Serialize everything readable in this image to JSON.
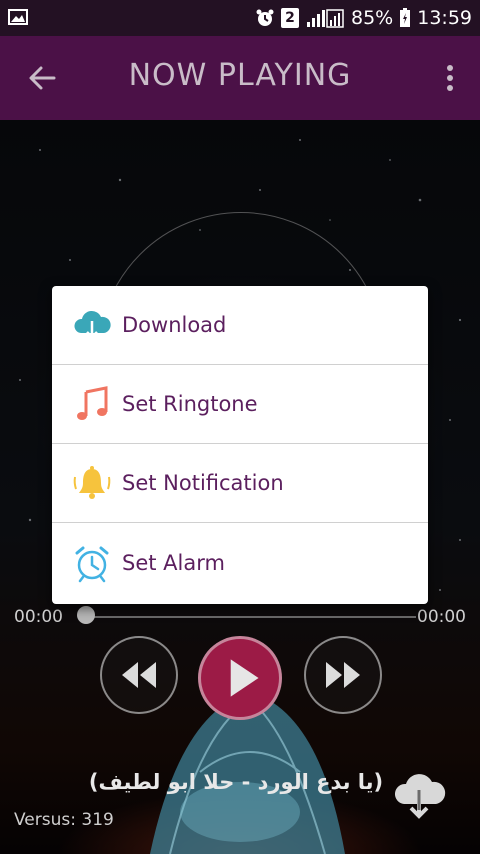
{
  "status_bar": {
    "sim_badge": "2",
    "battery": "85%",
    "time": "13:59"
  },
  "app_bar": {
    "title": "NOW PLAYING"
  },
  "player": {
    "elapsed": "00:00",
    "duration": "00:00",
    "progress": 0,
    "track_title": "(يا بدع الورد - حلا ابو لطيف)",
    "versus_label": "Versus: 319"
  },
  "dialog": {
    "items": [
      {
        "label": "Download",
        "icon": "cloud-download-icon"
      },
      {
        "label": "Set Ringtone",
        "icon": "music-note-icon"
      },
      {
        "label": "Set Notification",
        "icon": "bell-icon"
      },
      {
        "label": "Set Alarm",
        "icon": "alarm-clock-icon"
      }
    ]
  },
  "colors": {
    "status_bar": "#231123",
    "app_bar": "#4b1147",
    "title_text": "#c9bcc8",
    "play_button": "#9c1b46",
    "dialog_text": "#5b1f5e"
  }
}
